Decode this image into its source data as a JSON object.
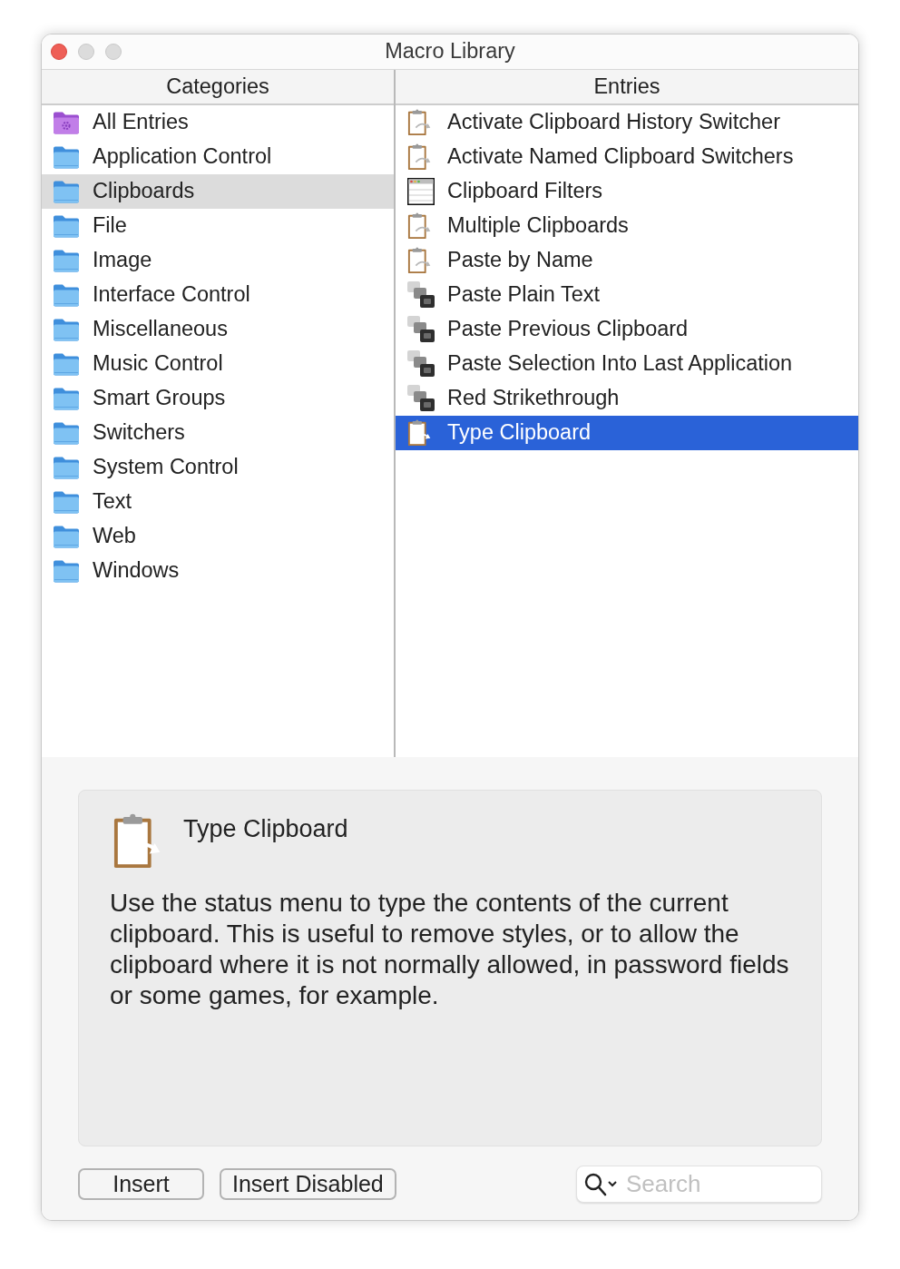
{
  "window": {
    "title": "Macro Library"
  },
  "categories": {
    "header": "Categories",
    "items": [
      {
        "label": "All Entries",
        "kind": "smart",
        "selected": false
      },
      {
        "label": "Application Control",
        "kind": "folder",
        "selected": false
      },
      {
        "label": "Clipboards",
        "kind": "folder",
        "selected": true
      },
      {
        "label": "File",
        "kind": "folder",
        "selected": false
      },
      {
        "label": "Image",
        "kind": "folder",
        "selected": false
      },
      {
        "label": "Interface Control",
        "kind": "folder",
        "selected": false
      },
      {
        "label": "Miscellaneous",
        "kind": "folder",
        "selected": false
      },
      {
        "label": "Music Control",
        "kind": "folder",
        "selected": false
      },
      {
        "label": "Smart Groups",
        "kind": "folder",
        "selected": false
      },
      {
        "label": "Switchers",
        "kind": "folder",
        "selected": false
      },
      {
        "label": "System Control",
        "kind": "folder",
        "selected": false
      },
      {
        "label": "Text",
        "kind": "folder",
        "selected": false
      },
      {
        "label": "Web",
        "kind": "folder",
        "selected": false
      },
      {
        "label": "Windows",
        "kind": "folder",
        "selected": false
      }
    ]
  },
  "entries": {
    "header": "Entries",
    "items": [
      {
        "label": "Activate Clipboard History Switcher",
        "kind": "clipboard",
        "selected": false
      },
      {
        "label": "Activate Named Clipboard Switchers",
        "kind": "clipboard",
        "selected": false
      },
      {
        "label": "Clipboard Filters",
        "kind": "window",
        "selected": false
      },
      {
        "label": "Multiple Clipboards",
        "kind": "clipboard",
        "selected": false
      },
      {
        "label": "Paste by Name",
        "kind": "clipboard",
        "selected": false
      },
      {
        "label": "Paste Plain Text",
        "kind": "paste",
        "selected": false
      },
      {
        "label": "Paste Previous Clipboard",
        "kind": "paste",
        "selected": false
      },
      {
        "label": "Paste Selection Into Last Application",
        "kind": "paste",
        "selected": false
      },
      {
        "label": "Red Strikethrough",
        "kind": "paste",
        "selected": false
      },
      {
        "label": "Type Clipboard",
        "kind": "clipboard",
        "selected": true
      }
    ]
  },
  "detail": {
    "title": "Type Clipboard",
    "kind": "clipboard",
    "description": "Use the status menu to type the contents of the current clipboard. This is useful to remove styles, or to allow the clipboard where it is not normally allowed, in password fields or some games, for example."
  },
  "buttons": [
    "Insert",
    "Insert Disabled"
  ],
  "search": {
    "placeholder": "Search"
  }
}
